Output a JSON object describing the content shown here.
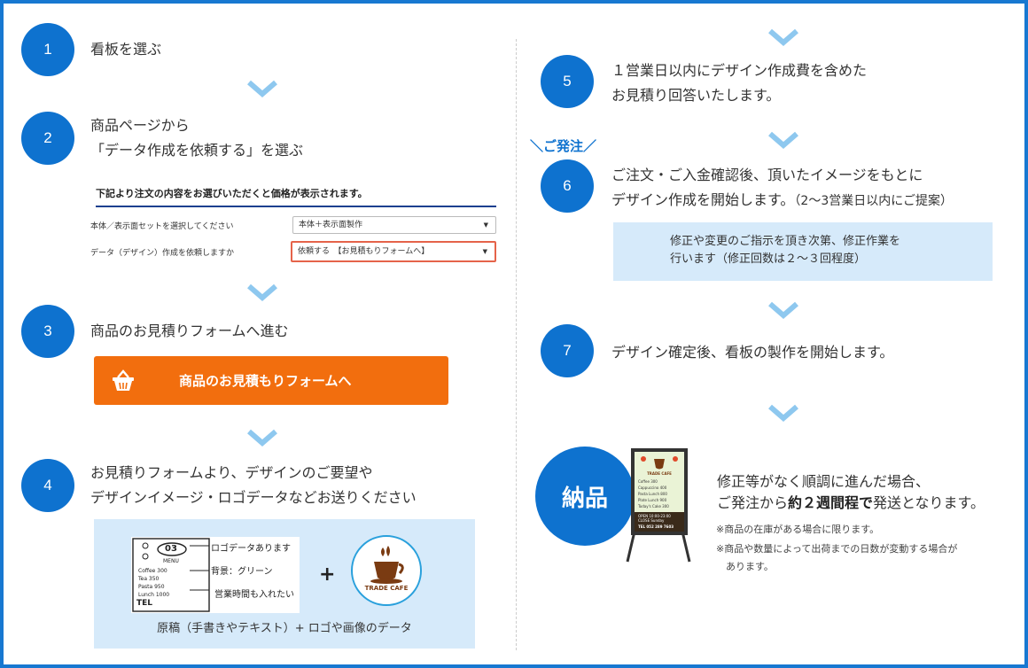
{
  "steps": [
    {
      "num": "1",
      "line1": "看板を選ぶ",
      "line2": ""
    },
    {
      "num": "2",
      "line1": "商品ページから",
      "line2": "「データ作成を依頼する」を選ぶ"
    },
    {
      "num": "3",
      "line1": "商品のお見積りフォームへ進む",
      "line2": ""
    },
    {
      "num": "4",
      "line1": "お見積りフォームより、デザインのご要望や",
      "line2": "デザインイメージ・ロゴデータなどお送りください"
    },
    {
      "num": "5",
      "line1": "１営業日以内にデザイン作成費を含めた",
      "line2": "お見積り回答いたします。"
    },
    {
      "num": "6",
      "line1": "ご注文・ご入金確認後、頂いたイメージをもとに",
      "line2": "デザイン作成を開始します。",
      "line2_suffix": "（2〜3営業日以内にご提案）"
    },
    {
      "num": "7",
      "line1": "デザイン確定後、看板の製作を開始します。",
      "line2": ""
    }
  ],
  "form": {
    "title": "下記より注文の内容をお選びいただくと価格が表示されます。",
    "row1_label": "本体／表示面セットを選択してください",
    "row1_value": "本体＋表示面製作",
    "row2_label": "データ（デザイン）作成を依頼しますか",
    "row2_value": "依頼する　【お見積もりフォームへ】",
    "arrow": "▼"
  },
  "cta": {
    "label": "商品のお見積もりフォームへ",
    "icon": "basket-icon",
    "color": "#f26e0e"
  },
  "step4_panel": {
    "note1": "ロゴデータあります",
    "note2": "背景：グリーン",
    "note3": "営業時間も入れたい",
    "sketch_header": "03",
    "sketch_sub": "MENU",
    "sketch_items": [
      "Coffee 300",
      "Tea 350",
      "Pasta 950",
      "Lunch 1000"
    ],
    "sketch_tel": "TEL",
    "plus": "+",
    "logo_text": "TRADE CAFE",
    "caption": "原稿（手書きやテキスト）+ ロゴや画像のデータ"
  },
  "order_tag": "＼ご発注／",
  "step6_panel": {
    "line1": "修正や変更のご指示を頂き次第、修正作業を",
    "line2": "行います（修正回数は２〜３回程度）"
  },
  "delivery": {
    "circle": "納品",
    "line1": "修正等がなく順調に進んだ場合、",
    "line2_pre": "ご発注から",
    "line2_bold": "約２週間程で",
    "line2_post": "発送となります。",
    "note1": "※商品の在庫がある場合に限ります。",
    "note2": "※商品や数量によって出荷までの日数が変動する場合が",
    "note3": "　あります。"
  },
  "board": {
    "title": "TRADE CAFE",
    "items": [
      "Coffee 300",
      "Cappuccino 400",
      "Pasta Lunch 800",
      "Plate Lunch 900",
      "Today's Cake 300"
    ],
    "open": "OPEN 10:00-23:00",
    "closed": "CLOSE Sunday",
    "tel": "TEL 052 289 7603"
  },
  "colors": {
    "primary": "#0e72cf",
    "chevron": "#8ec8ef",
    "panel": "#d6eafa",
    "cta": "#f26e0e",
    "frame": "#1778d1"
  }
}
